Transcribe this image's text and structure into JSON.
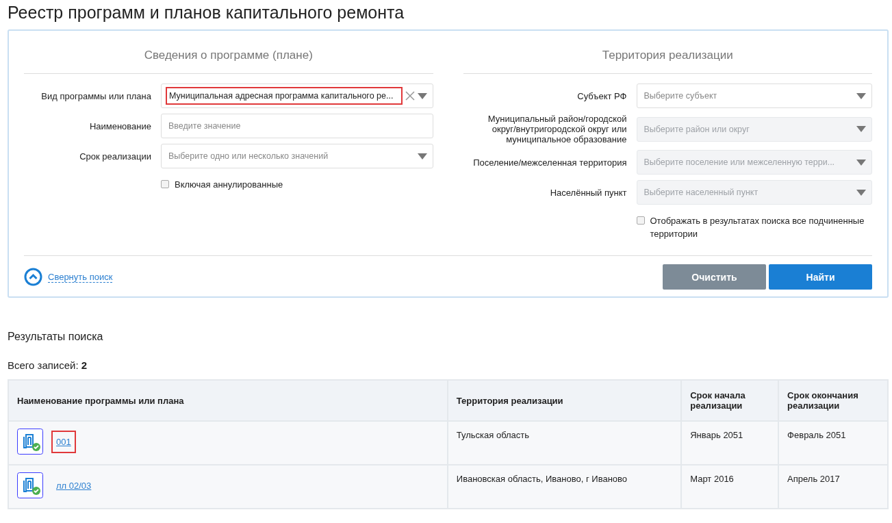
{
  "page_title": "Реестр программ и планов капитального ремонта",
  "search_panel": {
    "left": {
      "heading": "Сведения о программе (плане)",
      "fields": [
        {
          "label": "Вид программы или плана",
          "kind": "select",
          "value": "Муниципальная адресная программа капитального ре...",
          "disabled": false,
          "highlighted": true
        },
        {
          "label": "Наименование",
          "kind": "text",
          "placeholder": "Введите значение",
          "disabled": false
        },
        {
          "label": "Срок реализации",
          "kind": "select",
          "placeholder": "Выберите одно или несколько значений",
          "disabled": false
        }
      ],
      "checkbox": {
        "label": "Включая аннулированные",
        "checked": false
      }
    },
    "right": {
      "heading": "Территория реализации",
      "fields": [
        {
          "label": "Субъект РФ",
          "kind": "select",
          "placeholder": "Выберите субъект",
          "disabled": false
        },
        {
          "label": "Муниципальный район/городской округ/внутригородской округ или муниципальное образование",
          "kind": "select",
          "placeholder": "Выберите район или округ",
          "disabled": true
        },
        {
          "label": "Поселение/межселенная территория",
          "kind": "select",
          "placeholder": "Выберите поселение или межселенную терри...",
          "disabled": true
        },
        {
          "label": "Населённый пункт",
          "kind": "select",
          "placeholder": "Выберите населенный пункт",
          "disabled": true
        }
      ],
      "checkbox": {
        "label": "Отображать в результатах поиска все подчиненные территории",
        "checked": false
      }
    },
    "collapse_link": "Свернуть поиск",
    "buttons": [
      {
        "label": "Очистить",
        "kind": "secondary"
      },
      {
        "label": "Найти",
        "kind": "primary"
      }
    ]
  },
  "results": {
    "heading": "Результаты поиска",
    "total_label": "Всего записей:",
    "total_value": "2",
    "table": {
      "columns": [
        "Наименование программы или плана",
        "Территория реализации",
        "Срок начала реализации",
        "Срок окончания реализации"
      ],
      "rows": [
        {
          "name": "001",
          "highlighted": true,
          "territory": "Тульская область",
          "start": "Январь 2051",
          "end": "Февраль 2051"
        },
        {
          "name": "лл 02/03",
          "highlighted": false,
          "territory": "Ивановская область, Иваново, г Иваново",
          "start": "Март 2016",
          "end": "Апрель 2017"
        }
      ]
    }
  }
}
